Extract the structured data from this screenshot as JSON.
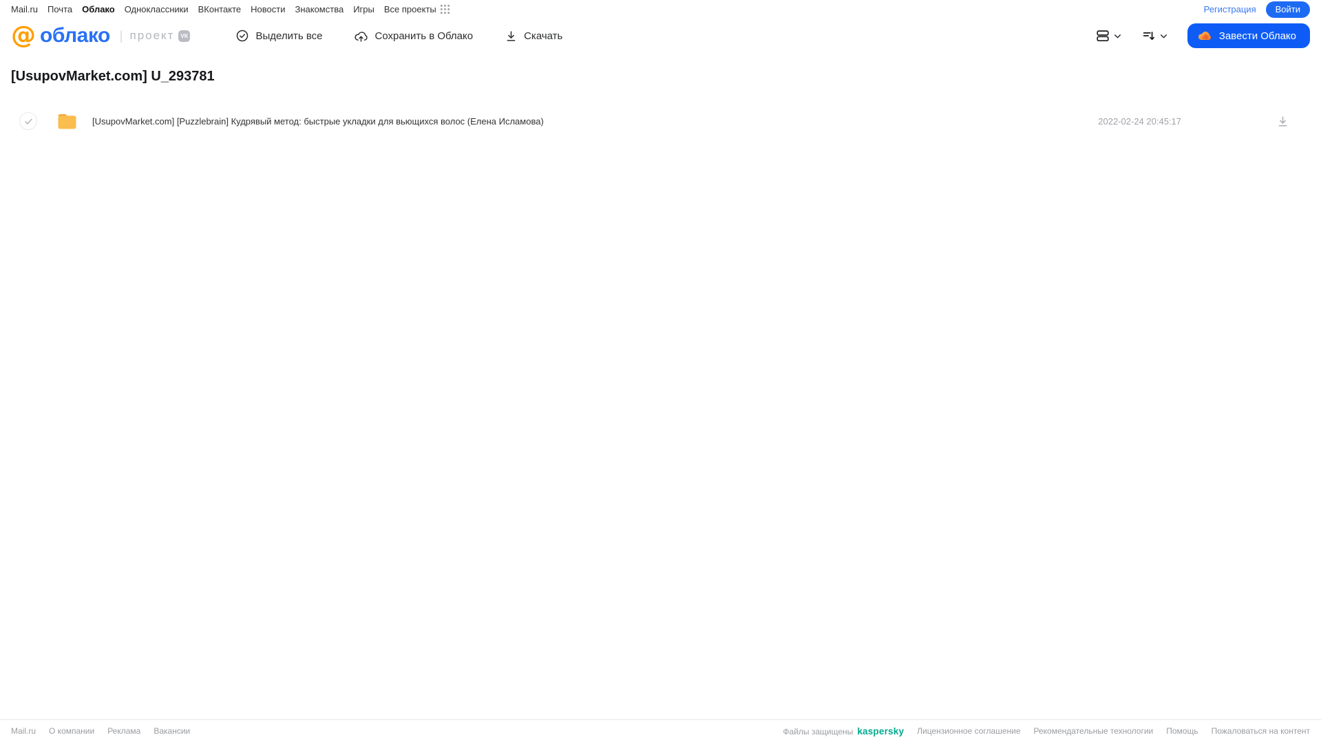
{
  "portal_nav": {
    "links": [
      "Mail.ru",
      "Почта",
      "Облако",
      "Одноклассники",
      "ВКонтакте",
      "Новости",
      "Знакомства",
      "Игры",
      "Все проекты"
    ],
    "active_link": "Облако",
    "registration_label": "Регистрация",
    "login_label": "Войти"
  },
  "header": {
    "logo_text": "облако",
    "logo_at_glyph": "@",
    "project_label": "проект",
    "vk_badge": "VK",
    "toolbar": {
      "select_all_label": "Выделить все",
      "save_to_cloud_label": "Сохранить в Облако",
      "download_label": "Скачать"
    },
    "get_cloud_label": "Завести Облако"
  },
  "main": {
    "title": "[UsupovMarket.com] U_293781",
    "files": [
      {
        "type": "folder",
        "name": "[UsupovMarket.com] [Puzzlebrain] Кудрявый метод: быстрые укладки для вьющихся волос (Елена Исламова)",
        "date": "2022-02-24 20:45:17"
      }
    ]
  },
  "footer": {
    "left_links": [
      "Mail.ru",
      "О компании",
      "Реклама",
      "Вакансии"
    ],
    "protected_label": "Файлы защищены",
    "kaspersky_logo_text": "kaspersky",
    "right_links": [
      "Лицензионное соглашение",
      "Рекомендательные технологии",
      "Помощь",
      "Пожаловаться на контент"
    ]
  },
  "icons": {
    "apps_grid": "apps-grid-icon",
    "select_all": "check-circle-icon",
    "save_cloud": "cloud-upload-icon",
    "download": "download-icon",
    "view_list": "list-view-icon",
    "sort": "sort-icon",
    "chevron": "chevron-down-icon",
    "cloud": "cloud-icon",
    "folder": "folder-icon"
  },
  "colors": {
    "accent_blue": "#0e5cf5",
    "link_blue": "#3a79f3",
    "logo_blue": "#2a71f5",
    "logo_orange": "#ff9e00",
    "folder_yellow": "#fbbd4d",
    "kaspersky_green": "#00a88e",
    "muted_gray": "#9a9ca1"
  }
}
